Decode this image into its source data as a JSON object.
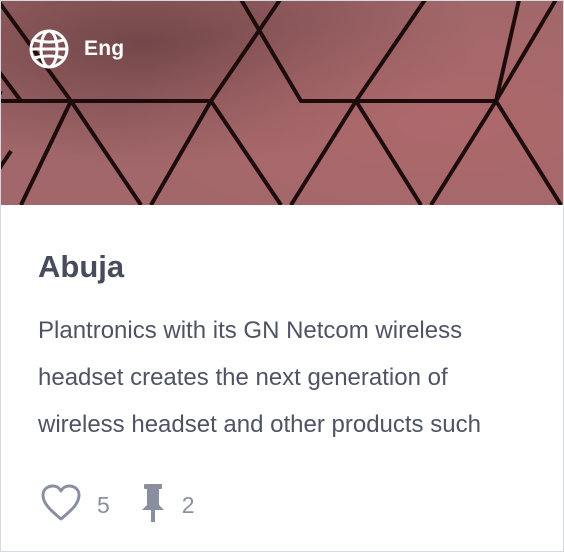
{
  "card": {
    "language_label": "Eng",
    "title": "Abuja",
    "description": "Plantronics with its GN Netcom wireless headset creates the next generation of wireless headset and other products such",
    "likes": "5",
    "pins": "2"
  },
  "icons": {
    "globe": "globe-icon",
    "heart": "heart-icon",
    "pin": "pin-icon"
  },
  "colors": {
    "hero_background": "#9b5f63",
    "title": "#474c5d",
    "text": "#4f5465",
    "muted": "#8a8fa0"
  }
}
